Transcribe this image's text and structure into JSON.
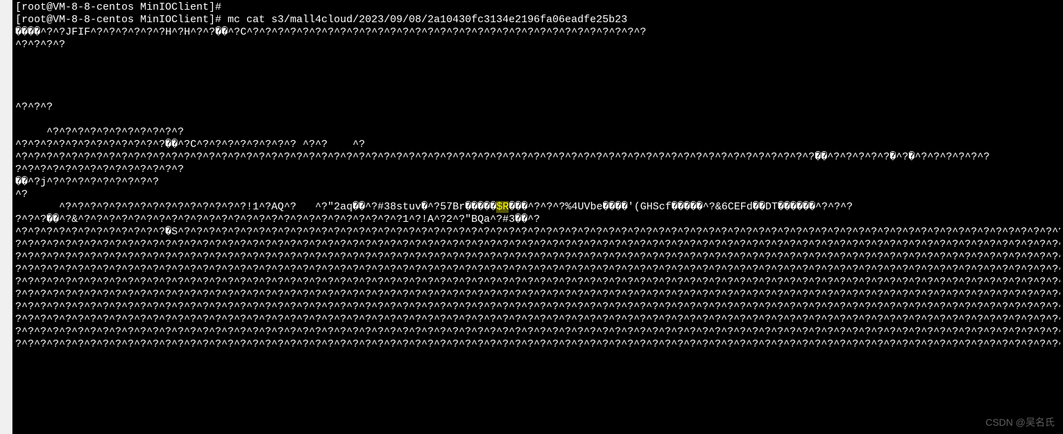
{
  "terminal": {
    "lines": [
      {
        "text": "[root@VM-8-8-centos MinIOClient]#"
      },
      {
        "text": "[root@VM-8-8-centos MinIOClient]# mc cat s3/mall4cloud/2023/09/08/2a10430fc3134e2196fa06eadfe25b23"
      },
      {
        "text": "����^?^?JFIF^?^?^?^?^?^?H^?H^?^?��^?C^?^?^?^?^?^?^?^?^?^?^?^?^?^?^?^?^?^?^?^?^?^?^?^?^?^?^?^?^?^?^?^?"
      },
      {
        "text": "^?^?^?^?"
      },
      {
        "text": ""
      },
      {
        "text": ""
      },
      {
        "text": ""
      },
      {
        "text": ""
      },
      {
        "text": "^?^?^?"
      },
      {
        "text": ""
      },
      {
        "text": "     ^?^?^?^?^?^?^?^?^?^?^?"
      },
      {
        "text": "^?^?^?^?^?^?^?^?^?^?^?^?��^?C^?^?^?^?^?^?^?^? ^?^?    ^?"
      },
      {
        "text": "^?^?^?^?^?^?^?^?^?^?^?^?^?^?^?^?^?^?^?^?^?^?^?^?^?^?^?^?^?^?^?^?^?^?^?^?^?^?^?^?^?^?^?^?^?^?^?^?^?^?^?^?^?^?^?^?^?^?^?^?^?^?^?^?��^?^?^?^?^?�^?�^?^?^?^?^?^?"
      },
      {
        "text": "?^?^?^?^?^?^?^?^?^?^?^?^?^?"
      },
      {
        "text": "��^?j^?^?^?^?^?^?^?^?^?"
      },
      {
        "text": "^?"
      },
      {
        "segments": [
          {
            "text": "       ^?^?^?^?^?^?^?^?^?^?^?^?^?^?^?!1^?AQ^?   ^?\"2aq��^?#38stuv�^?57Br�����",
            "highlight": false
          },
          {
            "text": "$R",
            "highlight": true
          },
          {
            "text": "���^?^?^?%4UVbe����'(GHScf�����^?&6CEFd��DT������^?^?^?",
            "highlight": false
          }
        ]
      },
      {
        "text": "?^?^?��^?&^?^?^?^?^?^?^?^?^?^?^?^?^?^?^?^?^?^?^?^?^?^?^?^?^?^?1^?!A^?2^?\"BQa^?#3��^?"
      },
      {
        "text": "^?^?^?^?^?^?^?^?^?^?^?^?�S^?^?^?^?^?^?^?^?^?^?^?^?^?^?^?^?^?^?^?^?^?^?^?^?^?^?^?^?^?^?^?^?^?^?^?^?^?^?^?^?^?^?^?^?^?^?^?^?^?^?^?^?^?^?^?^?^?^?^?^?^?^?^?^?^?^?^?^?^?^?^?^?^?^?^?^?^?^?^?^?^?^?^?^?^?"
      },
      {
        "text": "?^?^?^?^?^?^?^?^?^?^?^?^?^?^?^?^?^?^?^?^?^?^?^?^?^?^?^?^?^?^?^?^?^?^?^?^?^?^?^?^?^?^?^?^?^?^?^?^?^?^?^?^?^?^?^?^?^?^?^?^?^?^?^?^?^?^?^?^?^?^?^?^?^?^?^?^?^?^?^?^?^?^?^?^?^?^?^?^?^?^?^?^?^?^?^?^?^?"
      },
      {
        "text": "?^?^?^?^?^?^?^?^?^?^?^?^?^?^?^?^?^?^?^?^?^?^?^?^?^?^?^?^?^?^?^?^?^?^?^?^?^?^?^?^?^?^?^?^?^?^?^?^?^?^?^?^?^?^?^?^?^?^?^?^?^?^?^?^?^?^?^?^?^?^?^?^?^?^?^?^?^?^?^?^?^?^?^?^?^?^?^?^?^?^?^?^?^?^?^?^?^?"
      },
      {
        "text": "?^?^?^?^?^?^?^?^?^?^?^?^?^?^?^?^?^?^?^?^?^?^?^?^?^?^?^?^?^?^?^?^?^?^?^?^?^?^?^?^?^?^?^?^?^?^?^?^?^?^?^?^?^?^?^?^?^?^?^?^?^?^?^?^?^?^?^?^?^?^?^?^?^?^?^?^?^?^?^?^?^?^?^?^?^?^?^?^?^?^?^?^?^?^?^?^?^?"
      },
      {
        "text": "?^?^?^?^?^?^?^?^?^?^?^?^?^?^?^?^?^?^?^?^?^?^?^?^?^?^?^?^?^?^?^?^?^?^?^?^?^?^?^?^?^?^?^?^?^?^?^?^?^?^?^?^?^?^?^?^?^?^?^?^?^?^?^?^?^?^?^?^?^?^?^?^?^?^?^?^?^?^?^?^?^?^?^?^?^?^?^?^?^?^?^?^?^?^?^?^?^?"
      },
      {
        "text": "?^?^?^?^?^?^?^?^?^?^?^?^?^?^?^?^?^?^?^?^?^?^?^?^?^?^?^?^?^?^?^?^?^?^?^?^?^?^?^?^?^?^?^?^?^?^?^?^?^?^?^?^?^?^?^?^?^?^?^?^?^?^?^?^?^?^?^?^?^?^?^?^?^?^?^?^?^?^?^?^?^?^?^?^?^?^?^?^?^?^?^?^?^?^?^?^?^?"
      },
      {
        "text": "?^?^?^?^?^?^?^?^?^?^?^?^?^?^?^?^?^?^?^?^?^?^?^?^?^?^?^?^?^?^?^?^?^?^?^?^?^?^?^?^?^?^?^?^?^?^?^?^?^?^?^?^?^?^?^?^?^?^?^?^?^?^?^?^?^?^?^?^?^?^?^?^?^?^?^?^?^?^?^?^?^?^?^?^?^?^?^?^?^?^?^?^?^?^?^?^?^?"
      },
      {
        "text": "?^?^?^?^?^?^?^?^?^?^?^?^?^?^?^?^?^?^?^?^?^?^?^?^?^?^?^?^?^?^?^?^?^?^?^?^?^?^?^?^?^?^?^?^?^?^?^?^?^?^?^?^?^?^?^?^?^?^?^?^?^?^?^?^?^?^?^?^?^?^?^?^?^?^?^?^?^?^?^?^?^?^?^?^?^?^?^?^?^?^?^?^?^?^?^?^?^?"
      },
      {
        "text": "?^?^?^?^?^?^?^?^?^?^?^?^?^?^?^?^?^?^?^?^?^?^?^?^?^?^?^?^?^?^?^?^?^?^?^?^?^?^?^?^?^?^?^?^?^?^?^?^?^?^?^?^?^?^?^?^?^?^?^?^?^?^?^?^?^?^?^?^?^?^?^?^?^?^?^?^?^?^?^?^?^?^?^?^?^?^?^?^?^?^?^?^?^?^?^?^?^?"
      },
      {
        "text": "?^?^?^?^?^?^?^?^?^?^?^?^?^?^?^?^?^?^?^?^?^?^?^?^?^?^?^?^?^?^?^?^?^?^?^?^?^?^?^?^?^?^?^?^?^?^?^?^?^?^?^?^?^?^?^?^?^?^?^?^?^?^?^?^?^?^?^?^?^?^?^?^?^?^?^?^?^?^?^?^?^?^?^?^?^?^?^?^?^?^?^?^?^?^?^?^?^?"
      }
    ]
  },
  "watermark": {
    "text": "CSDN @吴名氏"
  }
}
